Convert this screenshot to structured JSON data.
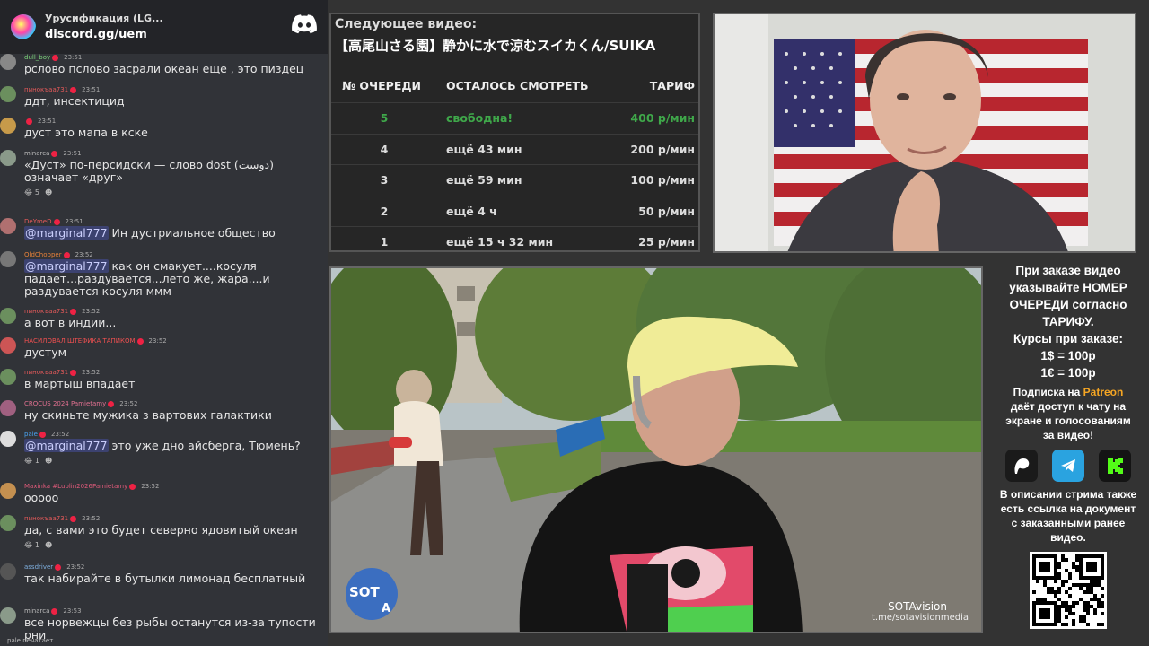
{
  "server": {
    "title": "Урусификация (LG...",
    "link": "discord.gg/uem"
  },
  "messages": [
    {
      "user": "dull_boy",
      "ucolor": "#7bd37b",
      "time": "23:51",
      "text": "рслово пслово засрали океан еще , это пиздец",
      "avatar": "#888"
    },
    {
      "user": "пинокъаа731",
      "ucolor": "#e55a5a",
      "time": "23:51",
      "text": "ддт, инсектицид",
      "avatar": "#6b8f5e"
    },
    {
      "user": "",
      "ucolor": "#aaa",
      "time": "23:51",
      "text": "дуст это мапа в кске",
      "avatar": "#c79a4a"
    },
    {
      "user": "minarca",
      "ucolor": "#bbb",
      "time": "23:51",
      "text": "«Дуст» по-персидски — слово dost (دوست) означает «друг»",
      "avatar": "#8a9a8a",
      "reacts": [
        "😂 5",
        "☻"
      ]
    },
    {
      "user": "DeYmeD",
      "ucolor": "#e55a5a",
      "time": "23:51",
      "mention": "@marginal777",
      "text": " Ин дустриальное общество",
      "avatar": "#b07070"
    },
    {
      "user": "OldChopper",
      "ucolor": "#e5803a",
      "time": "23:52",
      "mention": "@marginal777",
      "text": " как он смакует....косуля падает...раздувается...лето же, жара....и раздувается косуля ммм",
      "avatar": "#777"
    },
    {
      "user": "пинокъаа731",
      "ucolor": "#e55a5a",
      "time": "23:52",
      "text": "а вот в индии...",
      "avatar": "#6b8f5e"
    },
    {
      "user": "НАСИЛОВАЛ ШТЕФИКА ТАПИКОМ",
      "ucolor": "#f05050",
      "time": "23:52",
      "text": "дустум",
      "avatar": "#c55"
    },
    {
      "user": "пинокъаа731",
      "ucolor": "#e55a5a",
      "time": "23:52",
      "text": "в мартыш впадает",
      "avatar": "#6b8f5e"
    },
    {
      "user": "CROCUS 2024 Pamietamy",
      "ucolor": "#e07090",
      "time": "23:52",
      "text": "ну скиньте мужика з вартових галактики",
      "avatar": "#a06080"
    },
    {
      "user": "pale",
      "ucolor": "#4aa3f0",
      "time": "23:52",
      "mention": "@marginal777",
      "text": " это уже дно айсберга, Тюмень?",
      "avatar": "#ddd",
      "reacts": [
        "😂 1",
        "☻"
      ]
    },
    {
      "user": "Maxinka #Lublin2026Pamietamy",
      "ucolor": "#e05a7a",
      "time": "23:52",
      "text": "ооооо",
      "avatar": "#c49050"
    },
    {
      "user": "пинокъаа731",
      "ucolor": "#e55a5a",
      "time": "23:52",
      "text": "да, с вами это будет северно ядовитый океан",
      "avatar": "#6b8f5e",
      "reacts": [
        "😂 1",
        "☻"
      ]
    },
    {
      "user": "assdriver",
      "ucolor": "#7fb0e0",
      "time": "23:52",
      "text": "так набирайте в бутылки лимонад бесплатный",
      "avatar": "#555"
    },
    {
      "user": "minarca",
      "ucolor": "#bbb",
      "time": "23:53",
      "text": "все норвежцы без рыбы останутся из-за тупости рни",
      "avatar": "#8a9a8a"
    }
  ],
  "typing": "pale печатает...",
  "queue": {
    "next_label": "Следующее видео:",
    "next_title": "【高尾山さる園】静かに水で涼むスイカくん/SUIKA",
    "headers": {
      "num": "№ ОЧЕРЕДИ",
      "remain": "ОСТАЛОСЬ СМОТРЕТЬ",
      "rate": "ТАРИФ"
    },
    "rows": [
      {
        "num": "5",
        "remain": "свободна!",
        "rate": "400 р/мин",
        "free": true
      },
      {
        "num": "4",
        "remain": "ещё 43 мин",
        "rate": "200 р/мин"
      },
      {
        "num": "3",
        "remain": "ещё 59 мин",
        "rate": "100 р/мин"
      },
      {
        "num": "2",
        "remain": "ещё 4 ч",
        "rate": "50 р/мин"
      },
      {
        "num": "1",
        "remain": "ещё 15 ч 32 мин",
        "rate": "25 р/мин"
      }
    ]
  },
  "video": {
    "logo_text": "SOT",
    "logo_letter": "A",
    "watermark": "SOTAvision",
    "watermark_link": "t.me/sotavisionmedia"
  },
  "info": {
    "order_line1": "При заказе видео",
    "order_line2": "указывайте НОМЕР",
    "order_line3": "ОЧЕРЕДИ согласно",
    "order_line4": "ТАРИФУ.",
    "rates_title": "Курсы при заказе:",
    "rate_usd": "1$ = 100р",
    "rate_eur": "1€ = 100р",
    "sub_pre": "Подписка на ",
    "sub_brand": "Patreon",
    "sub_rest1": "даёт доступ к чату на",
    "sub_rest2": "экране и голосованиям",
    "sub_rest3": "за видео!",
    "desc1": "В описании стрима также",
    "desc2": "есть ссылка на документ",
    "desc3": "с заказанными ранее",
    "desc4": "видео."
  },
  "colors": {
    "free": "#3fa84a",
    "patreon": "#f6a623",
    "telegram": "#2aa3e0",
    "kick": "#53fc18"
  }
}
